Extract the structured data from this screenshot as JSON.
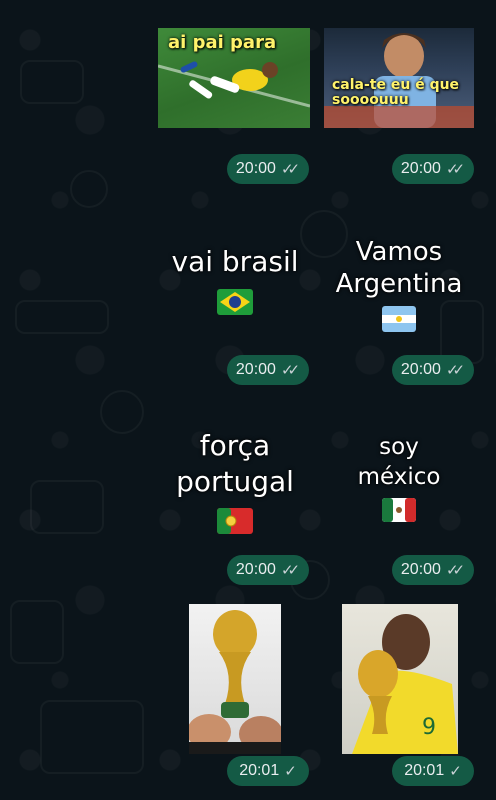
{
  "messages": [
    {
      "kind": "sticker-image",
      "caption": "ai pai para",
      "time": "20:00",
      "status_icon": "double-check-icon",
      "tick": "✓✓"
    },
    {
      "kind": "sticker-image",
      "caption": "cala-te eu é que soooouuu",
      "time": "20:00",
      "status_icon": "double-check-icon",
      "tick": "✓✓"
    },
    {
      "kind": "sticker-text",
      "text_lines": [
        "vai brasil"
      ],
      "flag": "brazil-flag-icon",
      "time": "20:00",
      "status_icon": "double-check-icon",
      "tick": "✓✓"
    },
    {
      "kind": "sticker-text",
      "text_lines": [
        "Vamos",
        "Argentina"
      ],
      "flag": "argentina-flag-icon",
      "time": "20:00",
      "status_icon": "double-check-icon",
      "tick": "✓✓"
    },
    {
      "kind": "sticker-text",
      "text_lines": [
        "força",
        "portugal"
      ],
      "flag": "portugal-flag-icon",
      "time": "20:00",
      "status_icon": "double-check-icon",
      "tick": "✓✓"
    },
    {
      "kind": "sticker-text",
      "text_lines": [
        "soy",
        "méxico"
      ],
      "flag": "mexico-flag-icon",
      "time": "20:00",
      "status_icon": "double-check-icon",
      "tick": "✓✓"
    },
    {
      "kind": "sticker-image",
      "image": "world-cup-trophy-image",
      "time": "20:01",
      "status_icon": "single-check-icon",
      "tick": "✓"
    },
    {
      "kind": "sticker-image",
      "image": "player-kissing-trophy-image",
      "time": "20:01",
      "status_icon": "single-check-icon",
      "tick": "✓"
    }
  ],
  "colors": {
    "background": "#0b141a",
    "time_badge": "#145a45",
    "caption_yellow": "#fff36b"
  }
}
